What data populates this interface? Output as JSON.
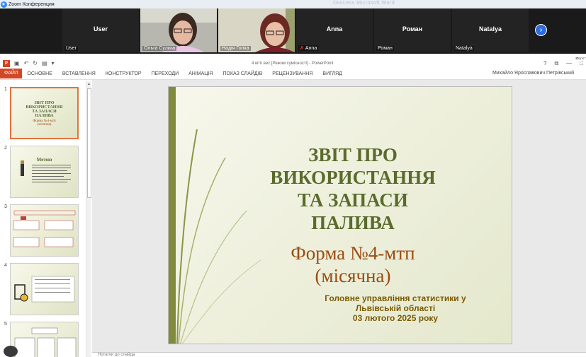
{
  "zoom": {
    "title": "Zoom Конференция",
    "faint_text": "ОкоLess    Microsoft Word",
    "participants": [
      {
        "center_name": "User",
        "label": "User",
        "video": false
      },
      {
        "center_name": "",
        "label": "Ольга Сулига",
        "video": true
      },
      {
        "center_name": "",
        "label": "Надія Голка",
        "video": true
      },
      {
        "center_name": "Anna",
        "label": "Anna",
        "video": false,
        "muted": true
      },
      {
        "center_name": "Роман",
        "label": "Роман",
        "video": false
      },
      {
        "center_name": "Natalya",
        "label": "Natalya",
        "video": false
      }
    ],
    "next_icon": "chevron-right-icon",
    "side_button": "Вид"
  },
  "ppt": {
    "window_title": "4 мтп вес [Режим сумісності] - PowerPoint",
    "tabs": [
      "ФАЙЛ",
      "ОСНОВНЕ",
      "ВСТАВЛЕННЯ",
      "КОНСТРУКТОР",
      "ПЕРЕХОДИ",
      "АНІМАЦІЯ",
      "ПОКАЗ СЛАЙДІВ",
      "РЕЦЕНЗУВАННЯ",
      "ВИГЛЯД"
    ],
    "user": "Михайло Ярославович Петрівський",
    "window_controls": [
      "?",
      "⧉",
      "—",
      "□"
    ],
    "notes_placeholder": "Нотатки до слайда",
    "thumbnails": [
      {
        "num": "1",
        "title": "ЗВІТ  ПРО ВИКОРИСТАННЯ ТА ЗАПАСИ ПАЛИВА",
        "sub": "Форма №4-мтп (місячна)",
        "selected": true
      },
      {
        "num": "2",
        "title": "Метою",
        "sub": "",
        "selected": false
      },
      {
        "num": "3",
        "title": "",
        "sub": "",
        "selected": false
      },
      {
        "num": "4",
        "title": "",
        "sub": "",
        "selected": false
      },
      {
        "num": "5",
        "title": "",
        "sub": "",
        "selected": false
      }
    ],
    "slide": {
      "title_lines": [
        "ЗВІТ  ПРО",
        "ВИКОРИСТАННЯ",
        "ТА ЗАПАСИ",
        "ПАЛИВА"
      ],
      "form_line1": "Форма №4-мтп",
      "form_line2": "(місячна)",
      "org_line1": "Головне управління статистики у",
      "org_line2": "Львівській області",
      "date_line": "03 лютого 2025 року"
    }
  }
}
